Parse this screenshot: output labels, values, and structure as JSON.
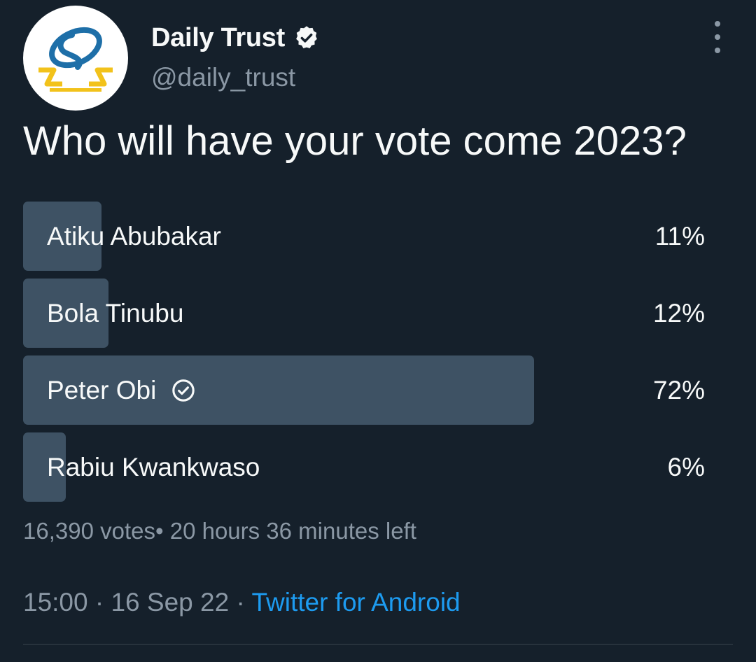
{
  "author": {
    "display_name": "Daily Trust",
    "handle": "@daily_trust",
    "verified": true,
    "avatar_icon": "daily-trust-logo-icon"
  },
  "tweet": {
    "text": "Who will have your vote come 2023?"
  },
  "poll": {
    "options": [
      {
        "label": "Atiku Abubakar",
        "percent_label": "11%",
        "percent": 11,
        "selected": false
      },
      {
        "label": "Bola Tinubu",
        "percent_label": "12%",
        "percent": 12,
        "selected": false
      },
      {
        "label": "Peter Obi",
        "percent_label": "72%",
        "percent": 72,
        "selected": true
      },
      {
        "label": "Rabiu Kwankwaso",
        "percent_label": "6%",
        "percent": 6,
        "selected": false
      }
    ],
    "votes": "16,390 votes",
    "separator": "•",
    "time_left": "20 hours 36 minutes left"
  },
  "meta": {
    "time": "15:00",
    "date": "16 Sep 22",
    "dot": "·",
    "source": "Twitter for Android"
  },
  "colors": {
    "background": "#15202b",
    "bar": "#3e5264",
    "muted_text": "#8b98a5",
    "link": "#1d9bf0",
    "logo_blue": "#1e6fa8",
    "logo_yellow": "#f2c21b"
  },
  "icons": {
    "verified": "verified-badge-icon",
    "more": "more-options-icon",
    "selected_check": "check-circle-icon"
  }
}
